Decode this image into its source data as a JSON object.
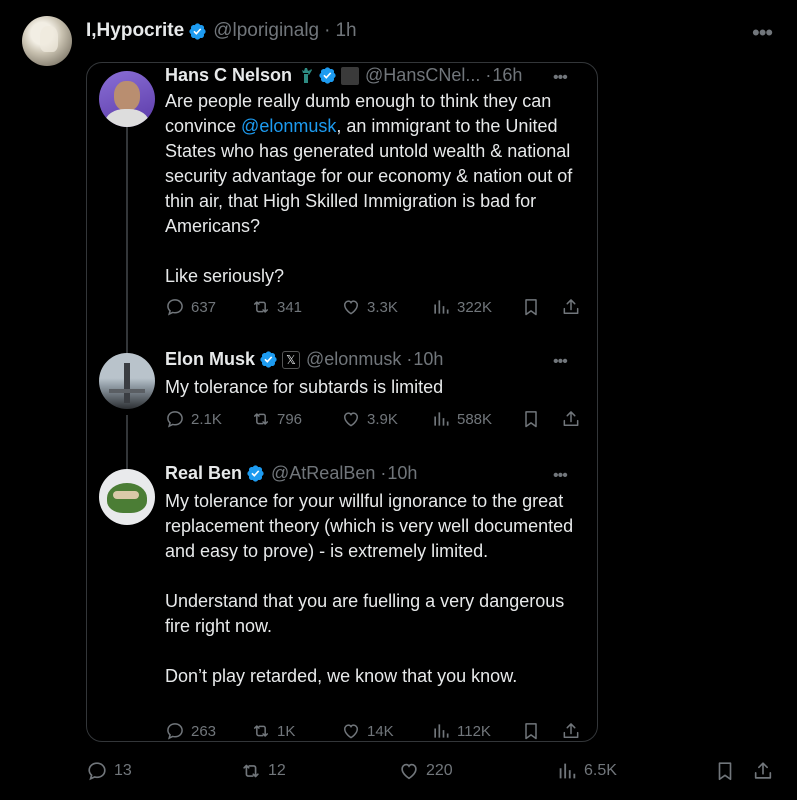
{
  "outer_tweet": {
    "author_name": "I,Hypocrite",
    "author_handle": "@lporiginalg",
    "time": "1h",
    "stats": {
      "replies": "13",
      "retweets": "12",
      "likes": "220",
      "views": "6.5K"
    }
  },
  "quoted_thread": [
    {
      "author_name": "Hans C Nelson",
      "author_handle": "@HansCNel...",
      "time": "16h",
      "text_before_mention": "Are people really dumb enough to think they can convince ",
      "mention": "@elonmusk",
      "text_after_mention": ", an immigrant to the United States who has generated untold wealth & national security advantage for our economy & nation out of thin air, that High Skilled Immigration is bad for Americans?\n\nLike seriously?",
      "stats": {
        "replies": "637",
        "retweets": "341",
        "likes": "3.3K",
        "views": "322K"
      }
    },
    {
      "author_name": "Elon Musk",
      "author_handle": "@elonmusk",
      "time": "10h",
      "text": "My tolerance for subtards is limited",
      "stats": {
        "replies": "2.1K",
        "retweets": "796",
        "likes": "3.9K",
        "views": "588K"
      }
    },
    {
      "author_name": "Real Ben",
      "author_handle": "@AtRealBen",
      "time": "10h",
      "text": "My tolerance for your willful ignorance to the great replacement theory (which is very well documented and easy to prove) - is extremely limited.\n\nUnderstand that you are fuelling a very dangerous fire right now.\n\nDon’t play retarded, we know that you know.",
      "stats": {
        "replies": "263",
        "retweets": "1K",
        "likes": "14K",
        "views": "112K"
      }
    }
  ],
  "separator_dot": "·",
  "x_badge_glyph": "𝕏",
  "colors": {
    "background": "#000000",
    "text": "#e7e9ea",
    "muted": "#71767b",
    "accent": "#1d9bf0",
    "border": "#333639"
  },
  "icons": [
    "more-icon",
    "verified-icon",
    "reply-icon",
    "retweet-icon",
    "like-icon",
    "views-icon",
    "bookmark-icon",
    "share-icon"
  ]
}
